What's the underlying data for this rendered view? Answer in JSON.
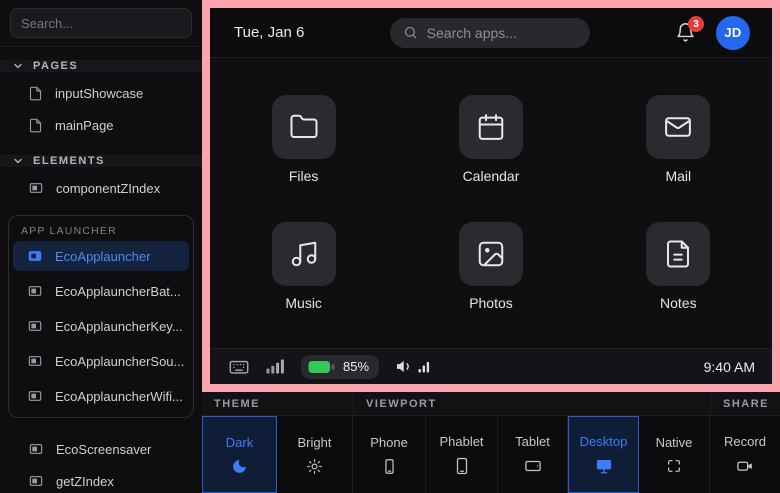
{
  "colors": {
    "frame_pink": "#fda4af",
    "accent_blue": "#3f7cf7",
    "selected_bg": "#16233e",
    "badge_red": "#e03e3c",
    "battery_green": "#34c85a",
    "avatar_blue": "#2468f2"
  },
  "sidebar": {
    "search": {
      "placeholder": "Search..."
    },
    "pages": {
      "label": "PAGES",
      "items": [
        {
          "label": "inputShowcase",
          "icon": "page-icon"
        },
        {
          "label": "mainPage",
          "icon": "page-icon"
        }
      ]
    },
    "elements": {
      "label": "ELEMENTS",
      "items": [
        {
          "label": "componentZIndex",
          "icon": "component-icon"
        }
      ]
    },
    "app_group": {
      "label": "APP LAUNCHER",
      "items": [
        {
          "label": "EcoApplauncher",
          "icon": "component-icon",
          "selected": true
        },
        {
          "label": "EcoApplauncherBat...",
          "icon": "component-icon",
          "selected": false
        },
        {
          "label": "EcoApplauncherKey...",
          "icon": "component-icon",
          "selected": false
        },
        {
          "label": "EcoApplauncherSou...",
          "icon": "component-icon",
          "selected": false
        },
        {
          "label": "EcoApplauncherWifi...",
          "icon": "component-icon",
          "selected": false
        }
      ]
    },
    "extra_items": [
      {
        "label": "EcoScreensaver",
        "icon": "component-icon"
      },
      {
        "label": "getZIndex",
        "icon": "component-icon"
      }
    ]
  },
  "launcher": {
    "topbar": {
      "date": "Tue, Jan 6",
      "search_placeholder": "Search apps...",
      "search_icon": "search-icon",
      "notification_count": "3",
      "notification_icon": "bell-icon",
      "avatar_initials": "JD"
    },
    "apps": [
      {
        "label": "Files",
        "icon": "folder-icon"
      },
      {
        "label": "Calendar",
        "icon": "calendar-icon"
      },
      {
        "label": "Mail",
        "icon": "mail-icon"
      },
      {
        "label": "Music",
        "icon": "music-icon"
      },
      {
        "label": "Photos",
        "icon": "photos-icon"
      },
      {
        "label": "Notes",
        "icon": "notes-icon"
      }
    ],
    "statusbar": {
      "icons": [
        "keyboard-icon",
        "cellular-signal-icon",
        "battery-icon",
        "volume-icon",
        "mini-signal-icon"
      ],
      "battery_percent": "85%",
      "time": "9:40 AM"
    }
  },
  "toolbar": {
    "groups": [
      {
        "label": "THEME",
        "buttons": [
          {
            "label": "Dark",
            "icon": "moon-icon",
            "selected": true
          },
          {
            "label": "Bright",
            "icon": "sun-icon",
            "selected": false
          }
        ]
      },
      {
        "label": "VIEWPORT",
        "buttons": [
          {
            "label": "Phone",
            "icon": "phone-icon",
            "selected": false
          },
          {
            "label": "Phablet",
            "icon": "phablet-icon",
            "selected": false
          },
          {
            "label": "Tablet",
            "icon": "tablet-icon",
            "selected": false
          },
          {
            "label": "Desktop",
            "icon": "desktop-icon",
            "selected": true
          },
          {
            "label": "Native",
            "icon": "native-icon",
            "selected": false
          }
        ]
      },
      {
        "label": "SHARE",
        "buttons": [
          {
            "label": "Record",
            "icon": "record-icon",
            "selected": false
          }
        ]
      }
    ]
  }
}
